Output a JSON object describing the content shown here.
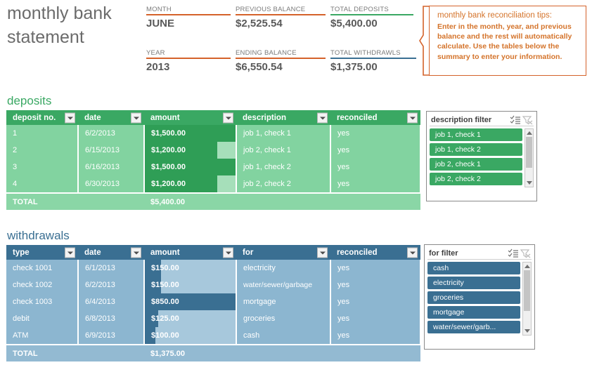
{
  "title": "monthly bank statement",
  "summary": {
    "fields": [
      {
        "label": "MONTH",
        "value": "JUNE",
        "rule_color": "#d4622a"
      },
      {
        "label": "PREVIOUS BALANCE",
        "value": "$2,525.54",
        "rule_color": "#d4622a"
      },
      {
        "label": "TOTAL DEPOSITS",
        "value": "$5,400.00",
        "rule_color": "#3aa863"
      },
      {
        "label": "YEAR",
        "value": "2013",
        "rule_color": "#d4622a"
      },
      {
        "label": "ENDING BALANCE",
        "value": "$6,550.54",
        "rule_color": "#d4622a"
      },
      {
        "label": "TOTAL WITHDRAWLS",
        "value": "$1,375.00",
        "rule_color": "#3a6f92"
      }
    ]
  },
  "tips": {
    "title": "monthly bank reconciliation tips:",
    "body": "Enter in the month, year, and previous balance and the rest will automatically calculate. Use the tables below the summary to enter your information.",
    "border_color": "#d4622a"
  },
  "deposits": {
    "heading": "deposits",
    "heading_color": "#3aa863",
    "columns": [
      "deposit no.",
      "date",
      "amount",
      "description",
      "reconciled"
    ],
    "rows": [
      {
        "no": "1",
        "date": "6/2/2013",
        "amount": "$1,500.00",
        "bar_pct": 100,
        "description": "job 1, check 1",
        "reconciled": "yes"
      },
      {
        "no": "2",
        "date": "6/15/2013",
        "amount": "$1,200.00",
        "bar_pct": 80,
        "description": "job 2, check 1",
        "reconciled": "yes"
      },
      {
        "no": "3",
        "date": "6/16/2013",
        "amount": "$1,500.00",
        "bar_pct": 100,
        "description": "job 1, check 2",
        "reconciled": "yes"
      },
      {
        "no": "4",
        "date": "6/30/2013",
        "amount": "$1,200.00",
        "bar_pct": 80,
        "description": "job 2, check 2",
        "reconciled": "yes"
      }
    ],
    "total_label": "TOTAL",
    "total_amount": "$5,400.00"
  },
  "withdrawals": {
    "heading": "withdrawals",
    "heading_color": "#3a6f92",
    "columns": [
      "type",
      "date",
      "amount",
      "for",
      "reconciled"
    ],
    "rows": [
      {
        "type": "check 1001",
        "date": "6/1/2013",
        "amount": "$150.00",
        "bar_pct": 18,
        "for": "electricity",
        "reconciled": "yes"
      },
      {
        "type": "check 1002",
        "date": "6/2/2013",
        "amount": "$150.00",
        "bar_pct": 18,
        "for": "water/sewer/garbage",
        "reconciled": "yes"
      },
      {
        "type": "check 1003",
        "date": "6/4/2013",
        "amount": "$850.00",
        "bar_pct": 100,
        "for": "mortgage",
        "reconciled": "yes"
      },
      {
        "type": "debit",
        "date": "6/8/2013",
        "amount": "$125.00",
        "bar_pct": 15,
        "for": "groceries",
        "reconciled": "yes"
      },
      {
        "type": "ATM",
        "date": "6/9/2013",
        "amount": "$100.00",
        "bar_pct": 12,
        "for": "cash",
        "reconciled": "yes"
      }
    ],
    "total_label": "TOTAL",
    "total_amount": "$1,375.00"
  },
  "description_slicer": {
    "title": "description filter",
    "items": [
      "job 1, check 1",
      "job 1, check 2",
      "job 2, check 1",
      "job 2, check 2"
    ],
    "item_color": "#3aa863",
    "multiselect_icon": "multi-select-icon",
    "clearfilter_icon": "clear-filter-icon"
  },
  "for_slicer": {
    "title": "for filter",
    "items": [
      "cash",
      "electricity",
      "groceries",
      "mortgage",
      "water/sewer/garb..."
    ],
    "item_color": "#3a6f92",
    "multiselect_icon": "multi-select-icon",
    "clearfilter_icon": "clear-filter-icon"
  }
}
